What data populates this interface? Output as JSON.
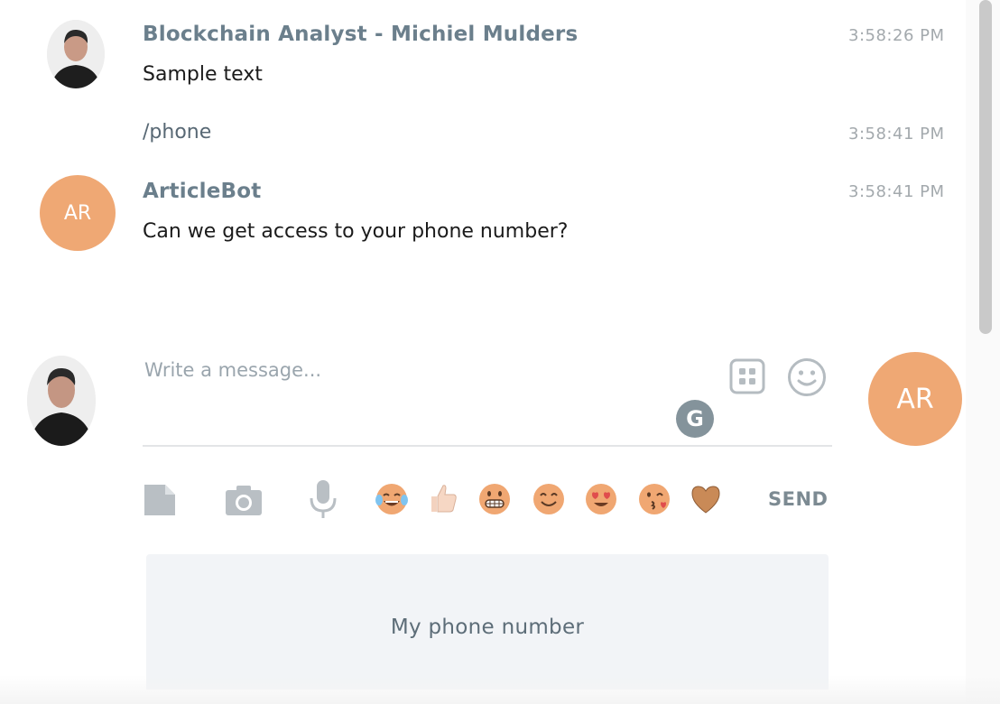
{
  "messages": [
    {
      "sender": "Blockchain Analyst - Michiel Mulders",
      "time": "3:58:26 PM",
      "lines": [
        {
          "text": "Sample text",
          "time": ""
        },
        {
          "text": "/phone",
          "time": "3:58:41 PM"
        }
      ]
    },
    {
      "sender": "ArticleBot",
      "avatar_initials": "AR",
      "time": "3:58:41 PM",
      "text": "Can we get access to your phone number?"
    }
  ],
  "composer": {
    "placeholder": "Write a message...",
    "send_label": "SEND",
    "bot_avatar_initials": "AR",
    "grammarly_letter": "G"
  },
  "emoji_buttons": [
    "tears-of-joy-emoji",
    "thumbs-up-emoji",
    "grimace-emoji",
    "smile-emoji",
    "heart-eyes-emoji",
    "kiss-emoji",
    "heart-emoji"
  ],
  "quick_reply": {
    "label": "My phone number"
  },
  "colors": {
    "accent": "#efa874",
    "sender": "#6b7f8c",
    "icon": "#b9bfc4"
  }
}
